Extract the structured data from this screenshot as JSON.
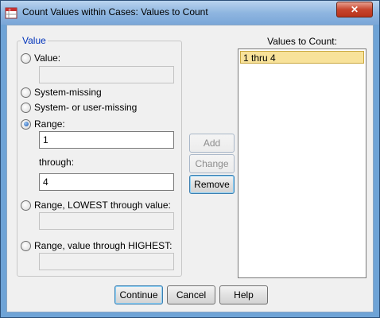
{
  "window": {
    "title": "Count Values within Cases: Values to Count",
    "close_glyph": "✕",
    "app_icon": "spss-dialog-icon"
  },
  "value_group": {
    "legend": "Value",
    "options": {
      "value": {
        "label": "Value:",
        "selected": false,
        "field_value": ""
      },
      "system_missing": {
        "label": "System-missing",
        "selected": false
      },
      "system_or_user_missing": {
        "label": "System- or user-missing",
        "selected": false
      },
      "range": {
        "label": "Range:",
        "selected": true,
        "from": "1",
        "through_label": "through:",
        "to": "4"
      },
      "range_lowest": {
        "label": "Range, LOWEST through value:",
        "selected": false,
        "field_value": ""
      },
      "range_highest": {
        "label": "Range, value through HIGHEST:",
        "selected": false,
        "field_value": ""
      }
    }
  },
  "middle_buttons": {
    "add": "Add",
    "change": "Change",
    "remove": "Remove"
  },
  "values_list": {
    "title": "Values to Count:",
    "items": [
      "1 thru 4"
    ]
  },
  "footer": {
    "continue": "Continue",
    "cancel": "Cancel",
    "help": "Help"
  }
}
